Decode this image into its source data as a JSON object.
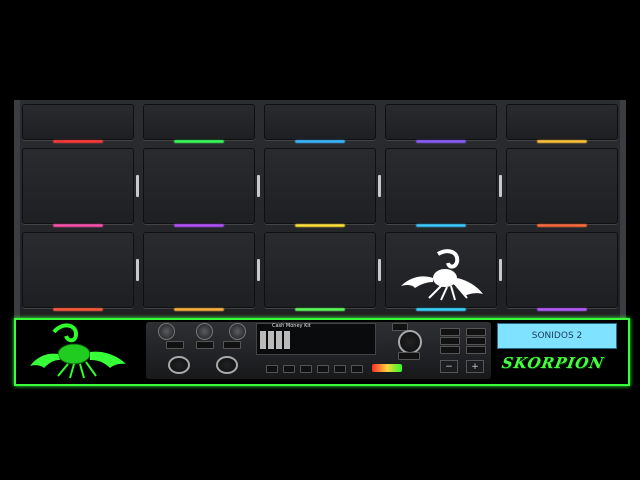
{
  "console": {
    "kit_name": "Cash Money Kit"
  },
  "panel": {
    "sound_bank_label": "SONIDOS 2",
    "brand_label": "SKORPION"
  },
  "colors": {
    "row1": [
      "#ff3a3a",
      "#37ff5a",
      "#39b8ff",
      "#8a5cff",
      "#ffc23a"
    ],
    "row2": [
      "#ff4fae",
      "#b44fff",
      "#ffe23a",
      "#39c8ff",
      "#ff6a3a"
    ],
    "row3": [
      "#ff5a3a",
      "#ffb23a",
      "#5aff5a",
      "#39d2ff",
      "#b45aff"
    ],
    "accent_green": "#38ff3a",
    "bank_display": "#7fe3ff"
  },
  "icons": {
    "left_logo": "green-scorpion-icon",
    "pad_logo": "white-scorpion-icon"
  }
}
